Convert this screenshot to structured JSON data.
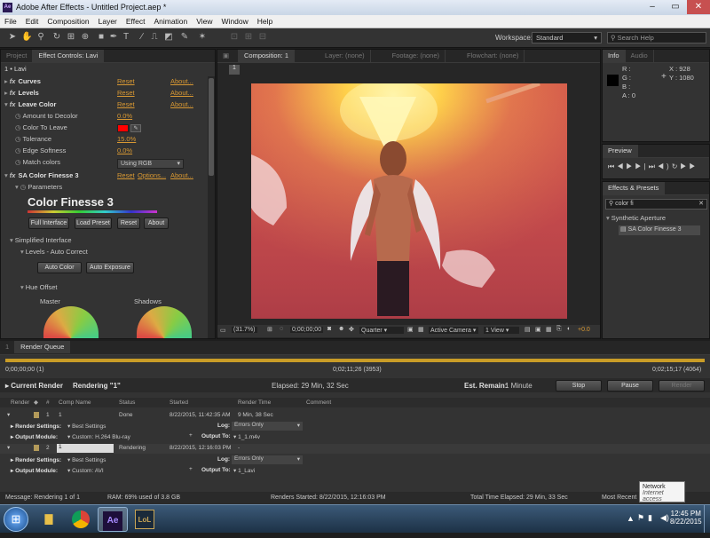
{
  "window": {
    "title": "Adobe After Effects - Untitled Project.aep *",
    "app_icon": "Ae"
  },
  "menu": [
    "File",
    "Edit",
    "Composition",
    "Layer",
    "Effect",
    "Animation",
    "View",
    "Window",
    "Help"
  ],
  "toolbar": {
    "workspace_label": "Workspace:",
    "workspace_value": "Standard",
    "search_placeholder": "Search Help"
  },
  "left_panel": {
    "tabs": [
      "Project",
      "Effect Controls: Lavi"
    ],
    "layer_path": "1 • Lavi",
    "effects": [
      {
        "name": "Curves",
        "reset": "Reset",
        "about": "About..."
      },
      {
        "name": "Levels",
        "reset": "Reset",
        "about": "About..."
      },
      {
        "name": "Leave Color",
        "reset": "Reset",
        "about": "About..."
      }
    ],
    "params": [
      {
        "label": "Amount to Decolor",
        "value": "0.0%"
      },
      {
        "label": "Color To Leave",
        "value": ""
      },
      {
        "label": "Tolerance",
        "value": "15.0%"
      },
      {
        "label": "Edge Softness",
        "value": "0.0%"
      },
      {
        "label": "Match colors",
        "value": "Using RGB"
      }
    ],
    "color_to_leave": "#ff0000",
    "sa": {
      "name": "SA Color Finesse 3",
      "reset": "Reset",
      "options": "Options...",
      "about": "About...",
      "parameters": "Parameters",
      "logo": "Color Finesse 3",
      "buttons": [
        "Full Interface",
        "Load Preset",
        "Reset",
        "About"
      ],
      "simplified": "Simplified Interface",
      "levels": "Levels - Auto Correct",
      "auto_buttons": [
        "Auto Color",
        "Auto Exposure"
      ],
      "hue_offset": "Hue Offset",
      "master": "Master",
      "shadows": "Shadows"
    }
  },
  "comp_panel": {
    "tabs": [
      "Composition: 1",
      "Layer: (none)",
      "Footage: (none)",
      "Flowchart: (none)"
    ],
    "comp_tab": "1",
    "zoom": "(31.7%)",
    "timecode": "0;00;00;00",
    "resolution": "Quarter",
    "camera": "Active Camera",
    "views": "1 View",
    "exposure": "+0.0"
  },
  "info": {
    "tabs": [
      "Info",
      "Audio"
    ],
    "r": "R :",
    "g": "G :",
    "b": "B :",
    "a": "A : 0",
    "x": "X : 928",
    "y": "Y : 1080"
  },
  "preview": {
    "title": "Preview"
  },
  "effects_presets": {
    "title": "Effects & Presets",
    "search": "color fi",
    "category": "Synthetic Aperture",
    "item": "SA Color Finesse 3"
  },
  "render_queue": {
    "tabs": [
      "1",
      "Render Queue"
    ],
    "start": "0;00;00;00 (1)",
    "mid": "0;02;11;26 (3953)",
    "end": "0;02;15;17 (4064)",
    "current_render_label": "Current Render",
    "rendering": "Rendering \"1\"",
    "elapsed": "Elapsed: 29 Min, 32 Sec",
    "remain_label": "Est. Remain:",
    "remain": "1 Minute",
    "stop": "Stop",
    "pause": "Pause",
    "render": "Render",
    "columns": [
      "Render",
      "#",
      "Comp Name",
      "Status",
      "Started",
      "Render Time",
      "Comment"
    ],
    "items": [
      {
        "num": "1",
        "comp": "1",
        "status": "Done",
        "started": "8/22/2015, 11:42:35 AM",
        "time": "9 Min, 38 Sec",
        "settings_label": "Render Settings:",
        "settings": "Best Settings",
        "log_label": "Log:",
        "log": "Errors Only",
        "module_label": "Output Module:",
        "module": "Custom: H.264 Blu-ray",
        "output_label": "Output To:",
        "output": "1_1.m4v"
      },
      {
        "num": "2",
        "comp": "1",
        "status": "Rendering",
        "started": "8/22/2015, 12:16:03 PM",
        "time": "-",
        "settings_label": "Render Settings:",
        "settings": "Best Settings",
        "log_label": "Log:",
        "log": "Errors Only",
        "module_label": "Output Module:",
        "module": "Custom: AVI",
        "output_label": "Output To:",
        "output": "1_Lavi"
      }
    ]
  },
  "status": {
    "message": "Message: Rendering 1 of 1",
    "ram": "RAM: 69% used of 3.8 GB",
    "renders_started": "Renders Started: 8/22/2015, 12:16:03 PM",
    "total_time": "Total Time Elapsed: 29 Min, 33 Sec",
    "most_recent": "Most Recent"
  },
  "tooltip": {
    "title": "Network",
    "sub": "Internet access"
  },
  "taskbar": {
    "ae": "Ae",
    "lol": "LoL",
    "time": "12:45 PM",
    "date": "8/22/2015"
  }
}
